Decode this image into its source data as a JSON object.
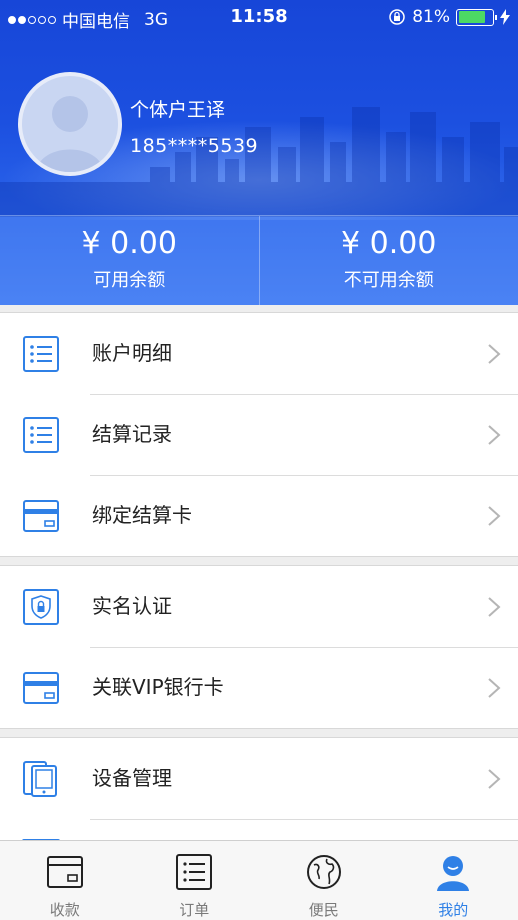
{
  "status_bar": {
    "carrier": "中国电信",
    "network": "3G",
    "time": "11:58",
    "battery_percent": "81%",
    "battery_level": 0.81,
    "signal_bars": 2
  },
  "profile": {
    "name": "个体户王译",
    "phone": "185****5539"
  },
  "balances": [
    {
      "amount": "¥ 0.00",
      "label": "可用余额"
    },
    {
      "amount": "¥ 0.00",
      "label": "不可用余额"
    }
  ],
  "menu": {
    "group1": [
      {
        "label": "账户明细",
        "icon": "list-icon"
      },
      {
        "label": "结算记录",
        "icon": "list-icon"
      },
      {
        "label": "绑定结算卡",
        "icon": "card-icon"
      }
    ],
    "group2": [
      {
        "label": "实名认证",
        "icon": "shield-lock-icon"
      },
      {
        "label": "关联VIP银行卡",
        "icon": "card-icon"
      }
    ],
    "group3": [
      {
        "label": "设备管理",
        "icon": "device-icon"
      }
    ]
  },
  "tabbar": [
    {
      "label": "收款",
      "icon": "wallet-icon",
      "active": false
    },
    {
      "label": "订单",
      "icon": "list-doc-icon",
      "active": false
    },
    {
      "label": "便民",
      "icon": "globe-icon",
      "active": false
    },
    {
      "label": "我的",
      "icon": "user-icon",
      "active": true
    }
  ],
  "colors": {
    "header_blue": "#1c50e0",
    "icon_blue": "#2f80e6",
    "active_tab": "#2f80e6",
    "battery_green": "#4cd964"
  }
}
